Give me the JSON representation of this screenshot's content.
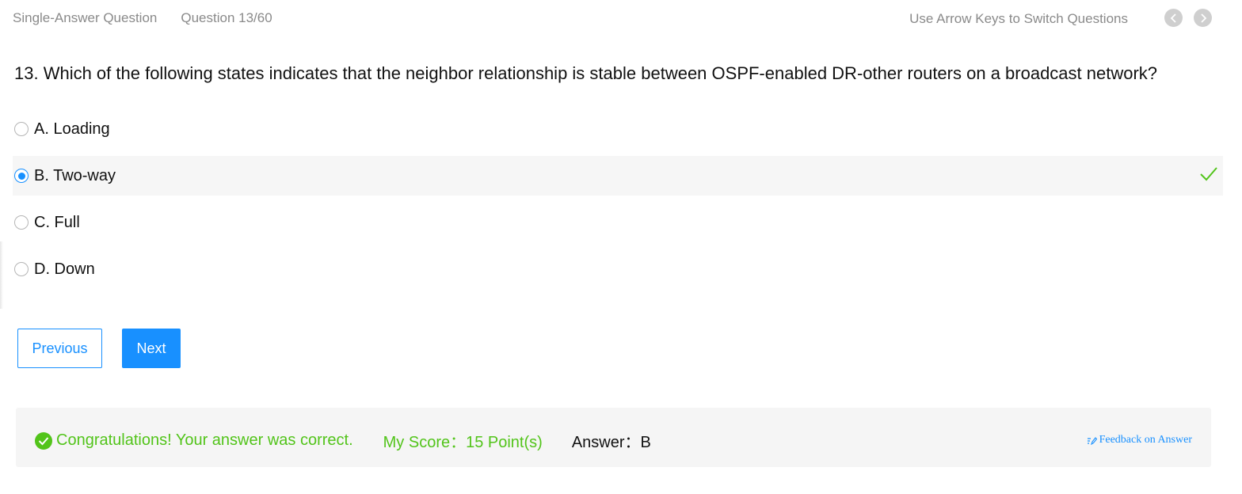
{
  "header": {
    "question_type": "Single-Answer Question",
    "question_counter": "Question 13/60",
    "hint": "Use Arrow Keys to Switch Questions",
    "prev_icon": "chevron-left-icon",
    "next_icon": "chevron-right-icon"
  },
  "question": {
    "text": "13. Which of the following states indicates that the neighbor relationship is stable between OSPF-enabled DR-other routers on a broadcast network?"
  },
  "options": [
    {
      "label": "A. Loading",
      "selected": false
    },
    {
      "label": "B. Two-way",
      "selected": true,
      "correct": true
    },
    {
      "label": "C. Full",
      "selected": false
    },
    {
      "label": "D. Down",
      "selected": false
    }
  ],
  "buttons": {
    "previous": "Previous",
    "next": "Next"
  },
  "result": {
    "message": "Congratulations! Your answer was correct.",
    "score": "My Score：15 Point(s)",
    "answer": "Answer：B",
    "feedback": "Feedback on Answer"
  },
  "colors": {
    "accent": "#1890ff",
    "success": "#52c41a",
    "muted": "#8a8a8a",
    "panel_bg": "#f5f5f5"
  }
}
